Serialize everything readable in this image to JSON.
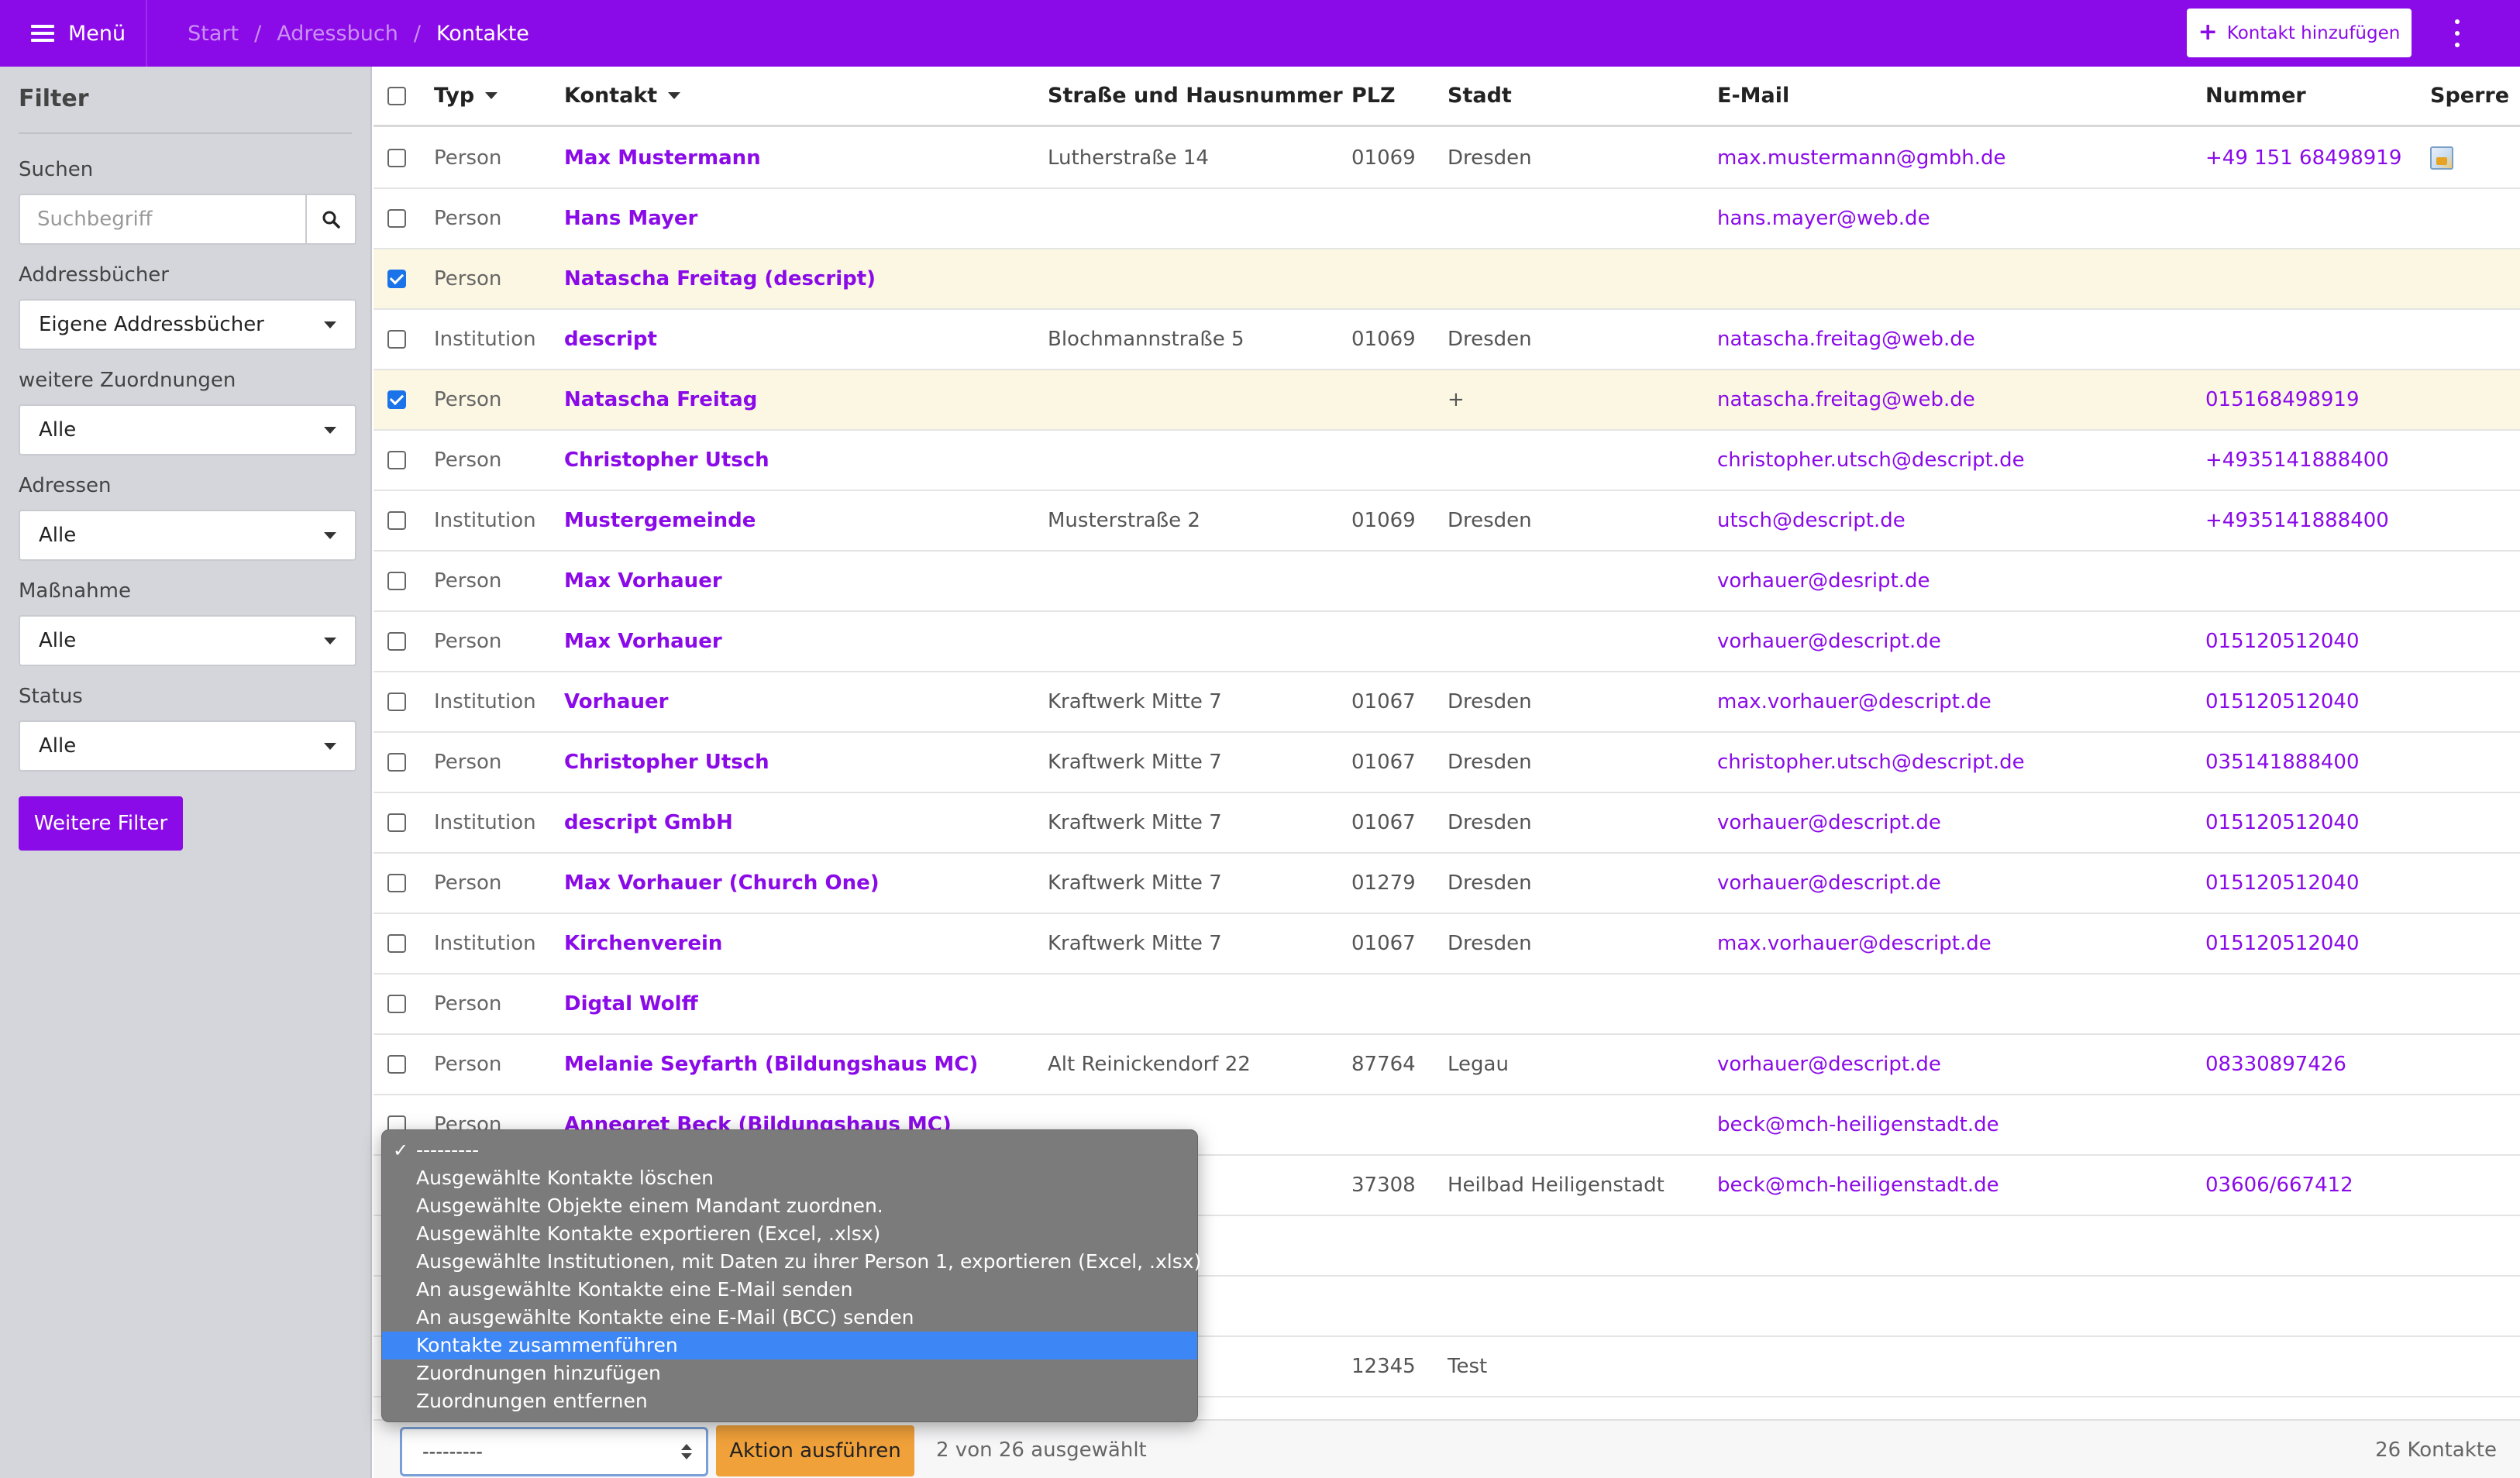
{
  "topbar": {
    "menu_label": "Menü",
    "breadcrumb": [
      "Start",
      "Adressbuch",
      "Kontakte"
    ],
    "add_contact_label": "Kontakt hinzufügen"
  },
  "sidebar": {
    "title": "Filter",
    "search_label": "Suchen",
    "search_placeholder": "Suchbegriff",
    "addressbooks_label": "Addressbücher",
    "addressbooks_value": "Eigene Addressbücher",
    "assignments_label": "weitere Zuordnungen",
    "assignments_value": "Alle",
    "addresses_label": "Adressen",
    "addresses_value": "Alle",
    "measure_label": "Maßnahme",
    "measure_value": "Alle",
    "status_label": "Status",
    "status_value": "Alle",
    "more_filters_label": "Weitere Filter"
  },
  "table": {
    "headers": {
      "typ": "Typ",
      "contact": "Kontakt",
      "street": "Straße und Hausnummer",
      "plz": "PLZ",
      "city": "Stadt",
      "email": "E-Mail",
      "phone": "Nummer",
      "lock": "Sperre"
    },
    "rows": [
      {
        "checked": false,
        "typ": "Person",
        "name": "Max Mustermann",
        "street": "Lutherstraße 14",
        "plz": "01069",
        "city": "Dresden",
        "email": "max.mustermann@gmbh.de",
        "phone": "+49 151 68498919",
        "lock": true
      },
      {
        "checked": false,
        "typ": "Person",
        "name": "Hans Mayer",
        "street": "",
        "plz": "",
        "city": "",
        "email": "hans.mayer@web.de",
        "phone": "",
        "lock": false
      },
      {
        "checked": true,
        "typ": "Person",
        "name": "Natascha Freitag (descript)",
        "street": "",
        "plz": "",
        "city": "",
        "email": "",
        "phone": "",
        "lock": false
      },
      {
        "checked": false,
        "typ": "Institution",
        "name": "descript",
        "street": "Blochmannstraße 5",
        "plz": "01069",
        "city": "Dresden",
        "email": "natascha.freitag@web.de",
        "phone": "",
        "lock": false
      },
      {
        "checked": true,
        "typ": "Person",
        "name": "Natascha Freitag",
        "street": "",
        "plz": "",
        "city": "+",
        "email": "natascha.freitag@web.de",
        "phone": "015168498919",
        "lock": false
      },
      {
        "checked": false,
        "typ": "Person",
        "name": "Christopher Utsch",
        "street": "",
        "plz": "",
        "city": "",
        "email": "christopher.utsch@descript.de",
        "phone": "+4935141888400",
        "lock": false
      },
      {
        "checked": false,
        "typ": "Institution",
        "name": "Mustergemeinde",
        "street": "Musterstraße 2",
        "plz": "01069",
        "city": "Dresden",
        "email": "utsch@descript.de",
        "phone": "+4935141888400",
        "lock": false
      },
      {
        "checked": false,
        "typ": "Person",
        "name": "Max Vorhauer",
        "street": "",
        "plz": "",
        "city": "",
        "email": "vorhauer@desript.de",
        "phone": "",
        "lock": false
      },
      {
        "checked": false,
        "typ": "Person",
        "name": "Max Vorhauer",
        "street": "",
        "plz": "",
        "city": "",
        "email": "vorhauer@descript.de",
        "phone": "015120512040",
        "lock": false
      },
      {
        "checked": false,
        "typ": "Institution",
        "name": "Vorhauer",
        "street": "Kraftwerk Mitte 7",
        "plz": "01067",
        "city": "Dresden",
        "email": "max.vorhauer@descript.de",
        "phone": "015120512040",
        "lock": false
      },
      {
        "checked": false,
        "typ": "Person",
        "name": "Christopher Utsch",
        "street": "Kraftwerk Mitte 7",
        "plz": "01067",
        "city": "Dresden",
        "email": "christopher.utsch@descript.de",
        "phone": "035141888400",
        "lock": false
      },
      {
        "checked": false,
        "typ": "Institution",
        "name": "descript GmbH",
        "street": "Kraftwerk Mitte 7",
        "plz": "01067",
        "city": "Dresden",
        "email": "vorhauer@descript.de",
        "phone": "015120512040",
        "lock": false
      },
      {
        "checked": false,
        "typ": "Person",
        "name": "Max Vorhauer (Church One)",
        "street": "Kraftwerk Mitte 7",
        "plz": "01279",
        "city": "Dresden",
        "email": "vorhauer@descript.de",
        "phone": "015120512040",
        "lock": false
      },
      {
        "checked": false,
        "typ": "Institution",
        "name": "Kirchenverein",
        "street": "Kraftwerk Mitte 7",
        "plz": "01067",
        "city": "Dresden",
        "email": "max.vorhauer@descript.de",
        "phone": "015120512040",
        "lock": false
      },
      {
        "checked": false,
        "typ": "Person",
        "name": "Digtal Wolff",
        "street": "",
        "plz": "",
        "city": "",
        "email": "",
        "phone": "",
        "lock": false
      },
      {
        "checked": false,
        "typ": "Person",
        "name": "Melanie Seyfarth (Bildungshaus MC)",
        "street": "Alt Reinickendorf 22",
        "plz": "87764",
        "city": "Legau",
        "email": "vorhauer@descript.de",
        "phone": "08330897426",
        "lock": false
      },
      {
        "checked": false,
        "typ": "Person",
        "name": "Annegret Beck (Bildungshaus MC)",
        "street": "",
        "plz": "",
        "city": "",
        "email": "beck@mch-heiligenstadt.de",
        "phone": "",
        "lock": false
      },
      {
        "checked": false,
        "typ": "",
        "name": "",
        "street": "",
        "plz": "37308",
        "city": "Heilbad Heiligenstadt",
        "email": "beck@mch-heiligenstadt.de",
        "phone": "03606/667412",
        "lock": false
      },
      {
        "checked": false,
        "typ": "",
        "name": "",
        "street": "",
        "plz": "",
        "city": "",
        "email": "",
        "phone": "",
        "lock": false
      },
      {
        "checked": false,
        "typ": "",
        "name": "",
        "street": "",
        "plz": "",
        "city": "",
        "email": "",
        "phone": "",
        "lock": false
      },
      {
        "checked": false,
        "typ": "",
        "name": "",
        "street": "",
        "plz": "12345",
        "city": "Test",
        "email": "",
        "phone": "",
        "lock": false
      }
    ]
  },
  "footer": {
    "action_select_value": "---------",
    "run_action_label": "Aktion ausführen",
    "selected_count_text": "2 von 26 ausgewählt",
    "total_count_text": "26 Kontakte"
  },
  "dropdown": {
    "items": [
      {
        "label": "---------",
        "checked": true,
        "highlight": false
      },
      {
        "label": "Ausgewählte Kontakte löschen",
        "checked": false,
        "highlight": false
      },
      {
        "label": "Ausgewählte Objekte einem Mandant zuordnen.",
        "checked": false,
        "highlight": false
      },
      {
        "label": "Ausgewählte Kontakte exportieren (Excel, .xlsx)",
        "checked": false,
        "highlight": false
      },
      {
        "label": "Ausgewählte Institutionen, mit Daten zu ihrer Person 1, exportieren (Excel, .xlsx)",
        "checked": false,
        "highlight": false
      },
      {
        "label": "An ausgewählte Kontakte eine E-Mail senden",
        "checked": false,
        "highlight": false
      },
      {
        "label": "An ausgewählte Kontakte eine E-Mail (BCC) senden",
        "checked": false,
        "highlight": false
      },
      {
        "label": "Kontakte zusammenführen",
        "checked": false,
        "highlight": true
      },
      {
        "label": "Zuordnungen hinzufügen",
        "checked": false,
        "highlight": false
      },
      {
        "label": "Zuordnungen entfernen",
        "checked": false,
        "highlight": false
      }
    ]
  },
  "colors": {
    "brand": "#8b0ae8",
    "selected_row": "#fcf7e3",
    "highlight": "#3d86f5",
    "action_button": "#f0a13a"
  }
}
